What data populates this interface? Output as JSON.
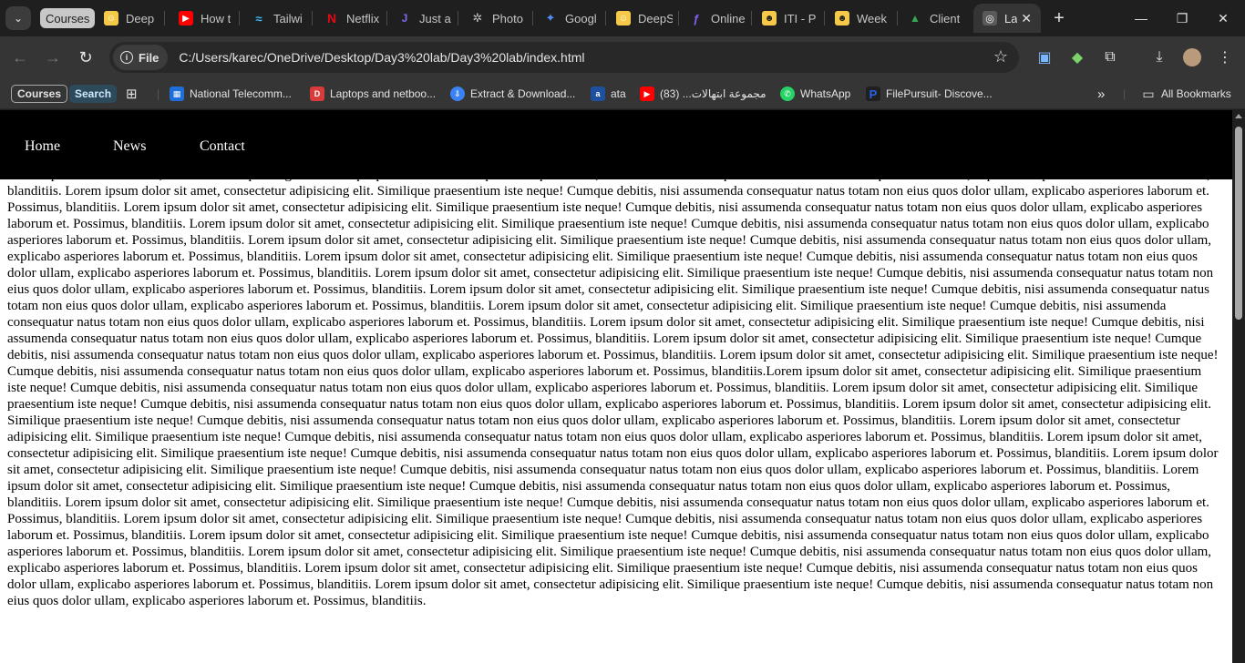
{
  "browser": {
    "tab_group_label": "Courses",
    "tabs": [
      {
        "title": "DeepS",
        "icon": "deepseek-icon",
        "color": "#f7c948"
      },
      {
        "title": "How t",
        "icon": "youtube-icon",
        "color": "#ff0000"
      },
      {
        "title": "Tailwi",
        "icon": "tailwind-icon",
        "color": "#38bdf8"
      },
      {
        "title": "Netflix",
        "icon": "netflix-icon",
        "color": "#e50914"
      },
      {
        "title": "Just a",
        "icon": "just-a-icon",
        "color": "#7c6cf0"
      },
      {
        "title": "Photo",
        "icon": "openai-icon",
        "color": "#bdbdbd"
      },
      {
        "title": "Googl",
        "icon": "gemini-icon",
        "color": "#4f8df7"
      },
      {
        "title": "DeepS",
        "icon": "deepseek-icon",
        "color": "#f7c948"
      },
      {
        "title": "Online",
        "icon": "online-icon",
        "color": "#8b5cf6"
      },
      {
        "title": "ITI - P",
        "icon": "iti-icon",
        "color": "#f7c948"
      },
      {
        "title": "Week",
        "icon": "week-icon",
        "color": "#f7c948"
      },
      {
        "title": "Client",
        "icon": "google-drive-icon",
        "color": "#34a853"
      }
    ],
    "active_tab": {
      "title": "La",
      "icon": "globe-icon",
      "close": "✕"
    },
    "new_tab": "+",
    "window_controls": {
      "minimize": "—",
      "maximize": "❐",
      "close": "✕"
    },
    "address_bar": {
      "scheme_label": "File",
      "url": "C:/Users/karec/OneDrive/Desktop/Day3%20lab/Day3%20lab/index.html"
    },
    "bookmarks": {
      "courses": "Courses",
      "search": "Search",
      "items": [
        {
          "label": "National Telecomm...",
          "icon": "nti-icon",
          "color": "#1e6fd9"
        },
        {
          "label": "Laptops and netboo...",
          "icon": "dell-icon",
          "color": "#d93a3a"
        },
        {
          "label": "Extract & Download...",
          "icon": "extract-icon",
          "color": "#3b82f6"
        },
        {
          "label": "ata",
          "icon": "ata-icon",
          "color": "#1e50a0"
        },
        {
          "label": "مجموعة ابتهالات... (83)",
          "icon": "youtube-icon",
          "color": "#ff0000"
        },
        {
          "label": "WhatsApp",
          "icon": "whatsapp-icon",
          "color": "#25d366"
        },
        {
          "label": "FilePursuit- Discove...",
          "icon": "filepursuit-icon",
          "color": "#2563eb"
        }
      ],
      "overflow": "»",
      "all_bookmarks": "All Bookmarks"
    }
  },
  "page": {
    "nav": {
      "home": "Home",
      "news": "News",
      "contact": "Contact"
    },
    "body_text": "Lorem ipsum dolor sit amet, consectetur adipisicing elit. Similique praesentium iste neque! Cumque debitis, nisi assumenda consequatur natus totam non eius quos dolor ullam, explicabo asperiores laborum et. Possimus, blanditiis. Lorem ipsum dolor sit amet, consectetur adipisicing elit. Similique praesentium iste neque! Cumque debitis, nisi assumenda consequatur natus totam non eius quos dolor ullam, explicabo asperiores laborum et. Possimus, blanditiis. Lorem ipsum dolor sit amet, consectetur adipisicing elit. Similique praesentium iste neque! Cumque debitis, nisi assumenda consequatur natus totam non eius quos dolor ullam, explicabo asperiores laborum et. Possimus, blanditiis. Lorem ipsum dolor sit amet, consectetur adipisicing elit. Similique praesentium iste neque! Cumque debitis, nisi assumenda consequatur natus totam non eius quos dolor ullam, explicabo asperiores laborum et. Possimus, blanditiis. Lorem ipsum dolor sit amet, consectetur adipisicing elit. Similique praesentium iste neque! Cumque debitis, nisi assumenda consequatur natus totam non eius quos dolor ullam, explicabo asperiores laborum et. Possimus, blanditiis. Lorem ipsum dolor sit amet, consectetur adipisicing elit. Similique praesentium iste neque! Cumque debitis, nisi assumenda consequatur natus totam non eius quos dolor ullam, explicabo asperiores laborum et. Possimus, blanditiis. Lorem ipsum dolor sit amet, consectetur adipisicing elit. Similique praesentium iste neque! Cumque debitis, nisi assumenda consequatur natus totam non eius quos dolor ullam, explicabo asperiores laborum et. Possimus, blanditiis. Lorem ipsum dolor sit amet, consectetur adipisicing elit. Similique praesentium iste neque! Cumque debitis, nisi assumenda consequatur natus totam non eius quos dolor ullam, explicabo asperiores laborum et. Possimus, blanditiis. Lorem ipsum dolor sit amet, consectetur adipisicing elit. Similique praesentium iste neque! Cumque debitis, nisi assumenda consequatur natus totam non eius quos dolor ullam, explicabo asperiores laborum et. Possimus, blanditiis. Lorem ipsum dolor sit amet, consectetur adipisicing elit. Similique praesentium iste neque! Cumque debitis, nisi assumenda consequatur natus totam non eius quos dolor ullam, explicabo asperiores laborum et. Possimus, blanditiis. Lorem ipsum dolor sit amet, consectetur adipisicing elit. Similique praesentium iste neque! Cumque debitis, nisi assumenda consequatur natus totam non eius quos dolor ullam, explicabo asperiores laborum et. Possimus, blanditiis. Lorem ipsum dolor sit amet, consectetur adipisicing elit. Similique praesentium iste neque! Cumque debitis, nisi assumenda consequatur natus totam non eius quos dolor ullam, explicabo asperiores laborum et. Possimus, blanditiis.Lorem ipsum dolor sit amet, consectetur adipisicing elit. Similique praesentium iste neque! Cumque debitis, nisi assumenda consequatur natus totam non eius quos dolor ullam, explicabo asperiores laborum et. Possimus, blanditiis. Lorem ipsum dolor sit amet, consectetur adipisicing elit. Similique praesentium iste neque! Cumque debitis, nisi assumenda consequatur natus totam non eius quos dolor ullam, explicabo asperiores laborum et. Possimus, blanditiis. Lorem ipsum dolor sit amet, consectetur adipisicing elit. Similique praesentium iste neque! Cumque debitis, nisi assumenda consequatur natus totam non eius quos dolor ullam, explicabo asperiores laborum et. Possimus, blanditiis. Lorem ipsum dolor sit amet, consectetur adipisicing elit. Similique praesentium iste neque! Cumque debitis, nisi assumenda consequatur natus totam non eius quos dolor ullam, explicabo asperiores laborum et. Possimus, blanditiis. Lorem ipsum dolor sit amet, consectetur adipisicing elit. Similique praesentium iste neque! Cumque debitis, nisi assumenda consequatur natus totam non eius quos dolor ullam, explicabo asperiores laborum et. Possimus, blanditiis. Lorem ipsum dolor sit amet, consectetur adipisicing elit. Similique praesentium iste neque! Cumque debitis, nisi assumenda consequatur natus totam non eius quos dolor ullam, explicabo asperiores laborum et. Possimus, blanditiis. Lorem ipsum dolor sit amet, consectetur adipisicing elit. Similique praesentium iste neque! Cumque debitis, nisi assumenda consequatur natus totam non eius quos dolor ullam, explicabo asperiores laborum et. Possimus, blanditiis. Lorem ipsum dolor sit amet, consectetur adipisicing elit. Similique praesentium iste neque! Cumque debitis, nisi assumenda consequatur natus totam non eius quos dolor ullam, explicabo asperiores laborum et. Possimus, blanditiis. Lorem ipsum dolor sit amet, consectetur adipisicing elit. Similique praesentium iste neque! Cumque debitis, nisi assumenda consequatur natus totam non eius quos dolor ullam, explicabo asperiores laborum et. Possimus, blanditiis. Lorem ipsum dolor sit amet, consectetur adipisicing elit. Similique praesentium iste neque! Cumque debitis, nisi assumenda consequatur natus totam non eius quos dolor ullam, explicabo asperiores laborum et. Possimus, blanditiis. Lorem ipsum dolor sit amet, consectetur adipisicing elit. Similique praesentium iste neque! Cumque debitis, nisi assumenda consequatur natus totam non eius quos dolor ullam, explicabo asperiores laborum et. Possimus, blanditiis. Lorem ipsum dolor sit amet, consectetur adipisicing elit. Similique praesentium iste neque! Cumque debitis, nisi assumenda consequatur natus totam non eius quos dolor ullam, explicabo asperiores laborum et. Possimus, blanditiis. Lorem ipsum dolor sit amet, consectetur adipisicing elit. Similique praesentium iste neque! Cumque debitis, nisi assumenda consequatur natus totam non eius quos dolor ullam, explicabo asperiores laborum et. Possimus, blanditiis."
  }
}
